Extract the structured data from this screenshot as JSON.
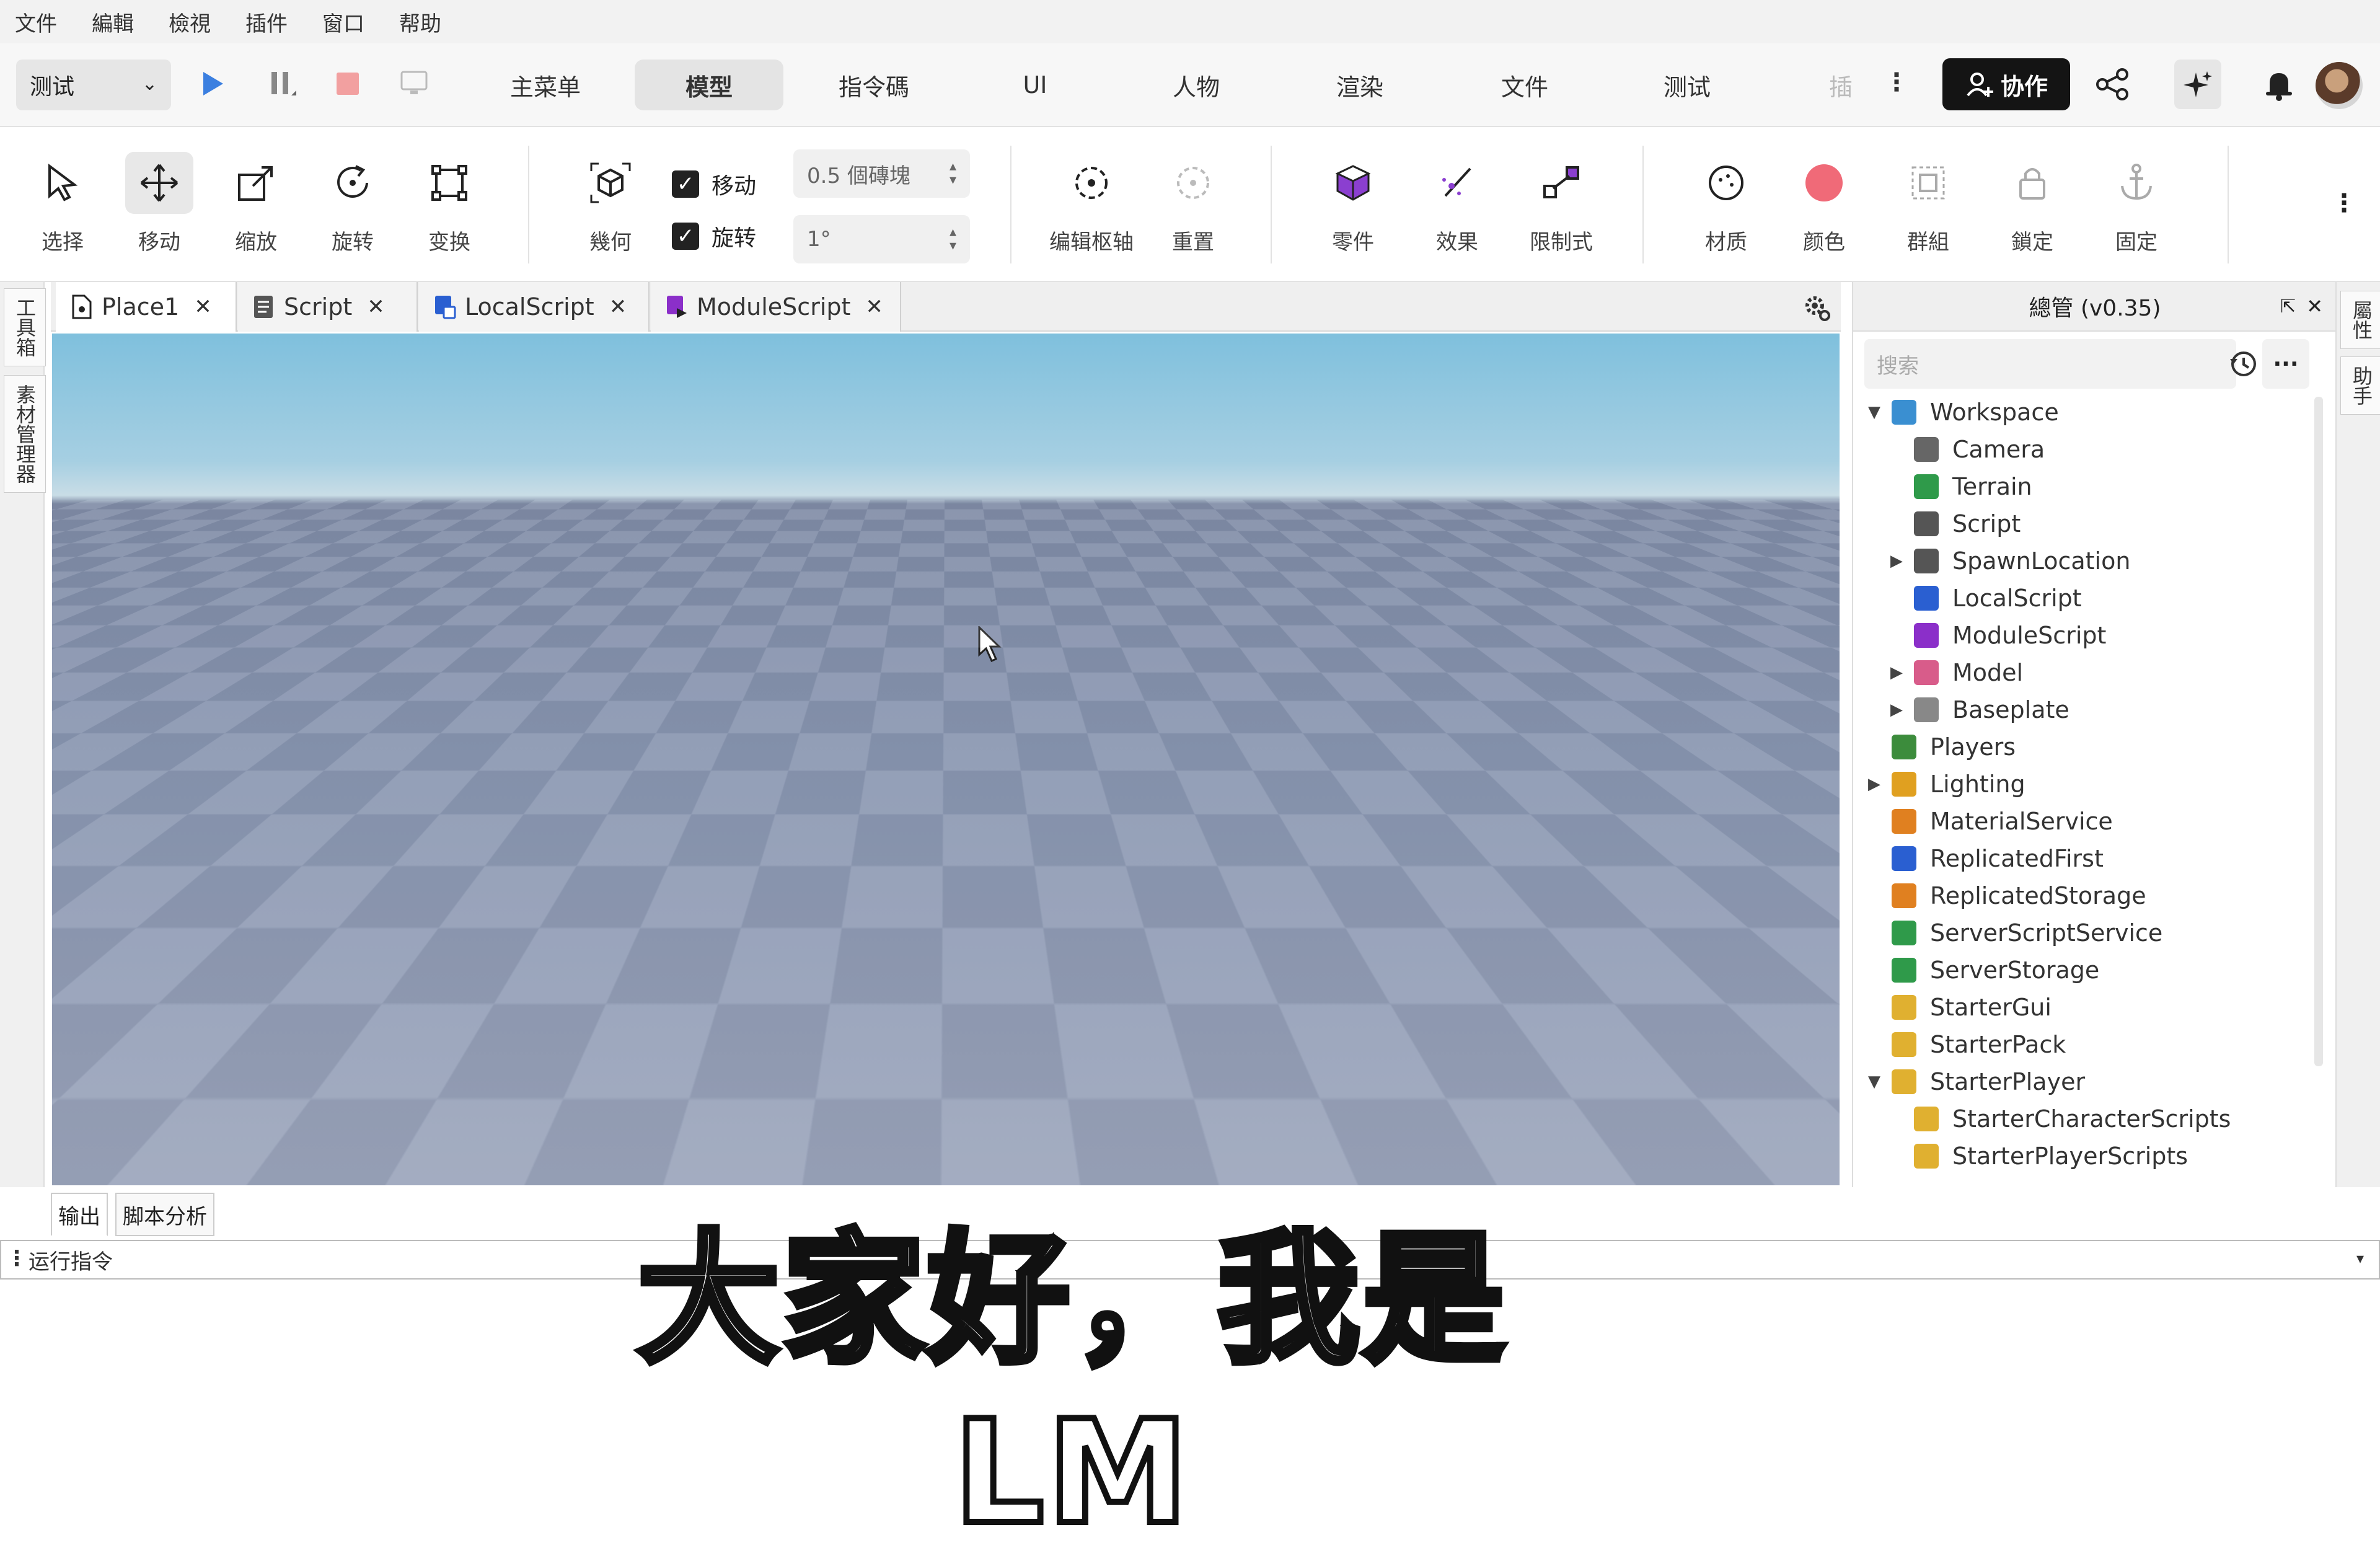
{
  "menubar": {
    "items": [
      "文件",
      "編輯",
      "檢視",
      "插件",
      "窗口",
      "帮助"
    ]
  },
  "toolbar": {
    "mode_select": "测试",
    "ribbon_tabs": [
      "主菜单",
      "模型",
      "指令碼",
      "UI",
      "人物",
      "渲染",
      "文件",
      "测试",
      "插"
    ],
    "active_tab": "模型",
    "collab_label": "协作"
  },
  "ribbon": {
    "tools": [
      "选择",
      "移动",
      "缩放",
      "旋转",
      "变换"
    ],
    "geometry_label": "幾何",
    "move_check_label": "移动",
    "rotate_check_label": "旋转",
    "move_increment": "0.5 個磚塊",
    "rotate_increment": "1°",
    "pivot_tools": [
      "编辑枢轴",
      "重置"
    ],
    "insert_tools": [
      "零件",
      "效果",
      "限制式"
    ],
    "appearance_tools": [
      "材质",
      "颜色",
      "群組",
      "鎖定",
      "固定"
    ]
  },
  "left_dock": {
    "tabs": [
      "工具箱",
      "素材管理器"
    ]
  },
  "right_dock": {
    "tabs": [
      "屬性",
      "助手"
    ]
  },
  "doc_tabs": [
    "Place1",
    "Script",
    "LocalScript",
    "ModuleScript"
  ],
  "explorer": {
    "title": "總管 (v0.35)",
    "search_placeholder": "搜索",
    "tree": [
      {
        "label": "Workspace",
        "depth": 0,
        "expanded": true,
        "icon": "globe-icon",
        "color": "#3a8fd1"
      },
      {
        "label": "Camera",
        "depth": 1,
        "icon": "camera-icon",
        "color": "#666666"
      },
      {
        "label": "Terrain",
        "depth": 1,
        "icon": "terrain-icon",
        "color": "#2f9a4a"
      },
      {
        "label": "Script",
        "depth": 1,
        "icon": "script-icon",
        "color": "#555555"
      },
      {
        "label": "SpawnLocation",
        "depth": 1,
        "collapsed": true,
        "icon": "spawn-icon",
        "color": "#555555"
      },
      {
        "label": "LocalScript",
        "depth": 1,
        "icon": "localscript-icon",
        "color": "#2a5fd1"
      },
      {
        "label": "ModuleScript",
        "depth": 1,
        "icon": "modulescript-icon",
        "color": "#8b2fc9"
      },
      {
        "label": "Model",
        "depth": 1,
        "collapsed": true,
        "icon": "model-icon",
        "color": "#d85c8a"
      },
      {
        "label": "Baseplate",
        "depth": 1,
        "collapsed": true,
        "icon": "part-icon",
        "color": "#888888"
      },
      {
        "label": "Players",
        "depth": 0,
        "icon": "players-icon",
        "color": "#3c8c3c"
      },
      {
        "label": "Lighting",
        "depth": 0,
        "collapsed": true,
        "icon": "bulb-icon",
        "color": "#e0a020"
      },
      {
        "label": "MaterialService",
        "depth": 0,
        "icon": "material-icon",
        "color": "#e08020"
      },
      {
        "label": "ReplicatedFirst",
        "depth": 0,
        "icon": "replicated-icon",
        "color": "#2a5fd1"
      },
      {
        "label": "ReplicatedStorage",
        "depth": 0,
        "icon": "storage-icon",
        "color": "#e08020"
      },
      {
        "label": "ServerScriptService",
        "depth": 0,
        "icon": "server-script-icon",
        "color": "#2f9a4a"
      },
      {
        "label": "ServerStorage",
        "depth": 0,
        "icon": "server-storage-icon",
        "color": "#2f9a4a"
      },
      {
        "label": "StarterGui",
        "depth": 0,
        "icon": "folder-icon",
        "color": "#e0b030"
      },
      {
        "label": "StarterPack",
        "depth": 0,
        "icon": "folder-icon",
        "color": "#e0b030"
      },
      {
        "label": "StarterPlayer",
        "depth": 0,
        "expanded": true,
        "icon": "folder-icon",
        "color": "#e0b030"
      },
      {
        "label": "StarterCharacterScripts",
        "depth": 1,
        "icon": "folder-icon",
        "color": "#e0b030"
      },
      {
        "label": "StarterPlayerScripts",
        "depth": 1,
        "icon": "folder-icon",
        "color": "#e0b030"
      }
    ]
  },
  "bottom": {
    "tabs": [
      "输出",
      "脚本分析"
    ],
    "command_placeholder": "运行指令"
  },
  "subtitle": "大家好，我是LM"
}
